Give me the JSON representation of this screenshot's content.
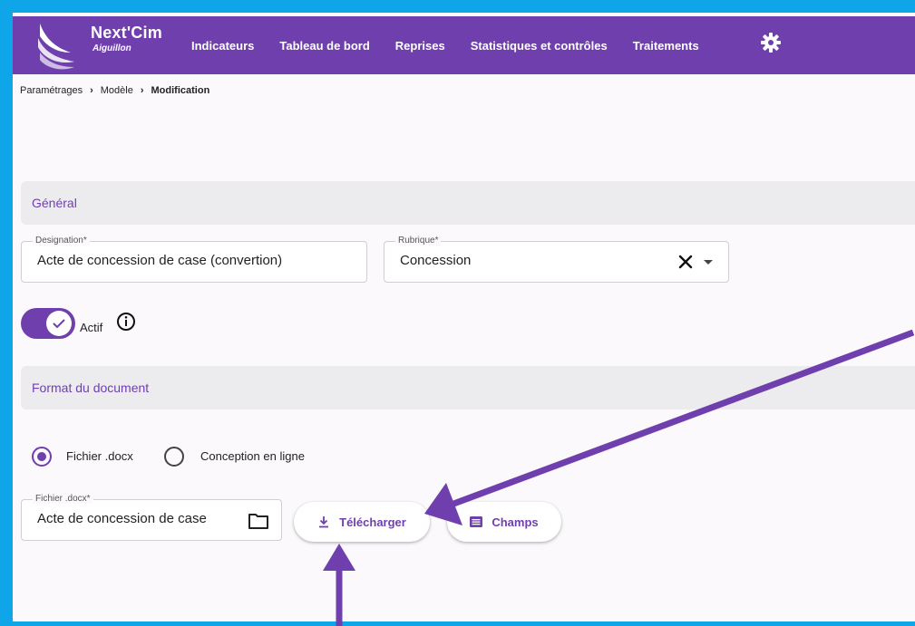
{
  "header": {
    "app_name": "Next'Cim",
    "app_subtitle": "Aiguillon",
    "nav": [
      "Indicateurs",
      "Tableau de bord",
      "Reprises",
      "Statistiques et contrôles",
      "Traitements"
    ],
    "settings_icon": "gear-icon"
  },
  "breadcrumb": [
    "Paramétrages",
    "Modèle",
    "Modification"
  ],
  "general": {
    "section_title": "Général",
    "designation_label": "Designation*",
    "designation_value": "Acte de concession de case (convertion)",
    "rubrique_label": "Rubrique*",
    "rubrique_value": "Concession",
    "actif_label": "Actif",
    "actif_on": true
  },
  "format": {
    "section_title": "Format du document",
    "options": [
      {
        "label": "Fichier .docx",
        "selected": true
      },
      {
        "label": "Conception en ligne",
        "selected": false
      }
    ],
    "file_label": "Fichier .docx*",
    "file_value": "Acte de concession de case",
    "download_button": "Télécharger",
    "fields_button": "Champs"
  },
  "colors": {
    "brand": "#6f3fae",
    "frame": "#0ea5e9"
  }
}
